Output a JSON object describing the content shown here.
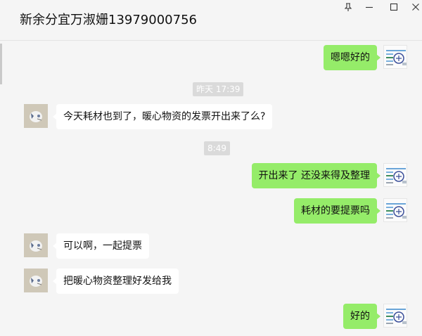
{
  "window": {
    "title": "新余分宜万淑姗13979000756"
  },
  "time_labels": [
    "昨天 17:39",
    "8:49"
  ],
  "messages": [
    {
      "from": "me",
      "text": "嗯嗯好的"
    },
    {
      "from": "other",
      "text": "今天耗材也到了，暖心物资的发票开出来了么?"
    },
    {
      "from": "me",
      "text": "开出来了 还没来得及整理"
    },
    {
      "from": "me",
      "text": "耗材的要提票吗"
    },
    {
      "from": "other",
      "text": "可以啊，一起提票"
    },
    {
      "from": "other",
      "text": "把暖心物资整理好发给我"
    },
    {
      "from": "me",
      "text": "好的"
    }
  ],
  "colors": {
    "my_bubble": "#95ec69",
    "other_bubble": "#ffffff",
    "background": "#f5f5f5"
  },
  "icons": [
    "pin-icon",
    "minimize-icon",
    "maximize-icon",
    "close-icon"
  ]
}
